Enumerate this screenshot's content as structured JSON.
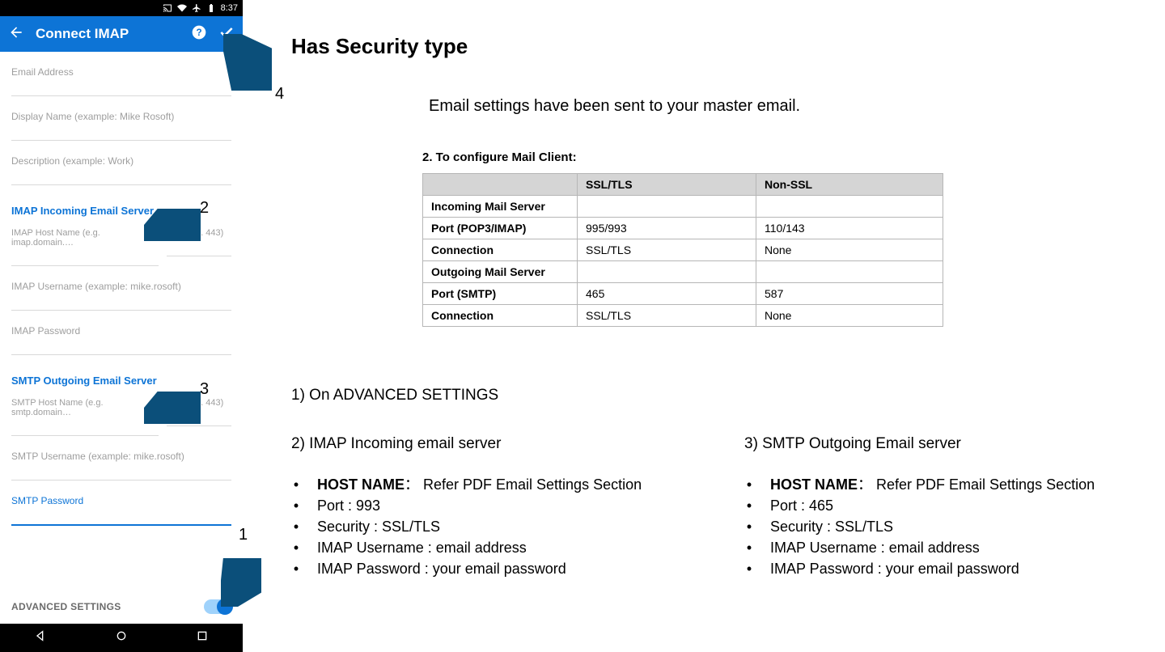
{
  "phone": {
    "status_time": "8:37",
    "title": "Connect IMAP",
    "fields": {
      "email": "Email Address",
      "display": "Display Name (example: Mike Rosoft)",
      "description": "Description (example: Work)"
    },
    "imap": {
      "heading": "IMAP Incoming Email Server",
      "host": "IMAP Host Name (e.g. imap.domain.…",
      "port": "Port (e.g. 443)",
      "user": "IMAP Username (example: mike.rosoft)",
      "pass": "IMAP Password"
    },
    "smtp": {
      "heading": "SMTP Outgoing Email Server",
      "host": "SMTP Host Name (e.g. smtp.domain…",
      "port": "Port (e.g. 443)",
      "user": "SMTP Username (example: mike.rosoft)",
      "pass": "SMTP Password"
    },
    "advanced": "ADVANCED SETTINGS"
  },
  "callouts": {
    "n1": "1",
    "n2": "2",
    "n3": "3",
    "n4": "4"
  },
  "doc": {
    "title": "Has Security type",
    "sent": "Email settings have been sent to your master email.",
    "config_head": "2. To configure Mail Client:",
    "table": {
      "col_ssl": "SSL/TLS",
      "col_non": "Non-SSL",
      "rows": {
        "r1": "Incoming Mail Server",
        "r2": "Port (POP3/IMAP)",
        "r3": "Connection",
        "r4": "Outgoing Mail Server",
        "r5": "Port (SMTP)",
        "r6": "Connection"
      },
      "vals": {
        "r2a": "995/993",
        "r2b": "110/143",
        "r3a": "SSL/TLS",
        "r3b": "None",
        "r5a": "465",
        "r5b": "587",
        "r6a": "SSL/TLS",
        "r6b": "None"
      }
    },
    "step1": "1) On ADVANCED SETTINGS",
    "step2": "2) IMAP Incoming email server",
    "step3": "3) SMTP Outgoing Email server",
    "imap_bullets": {
      "host_label": "HOST NAME",
      "host_rest": "：  Refer PDF Email Settings Section",
      "port": "Port : 993",
      "sec": "Security : SSL/TLS",
      "user": "IMAP Username : email address",
      "pass": "IMAP Password  :  your email password"
    },
    "smtp_bullets": {
      "host_label": "HOST NAME",
      "host_rest": "：  Refer PDF Email Settings Section",
      "port": "Port : 465",
      "sec": "Security : SSL/TLS",
      "user": "IMAP Username : email address",
      "pass": "IMAP Password  :  your email password"
    }
  },
  "chart_data": {
    "type": "table",
    "title": "To configure Mail Client",
    "columns": [
      "",
      "SSL/TLS",
      "Non-SSL"
    ],
    "rows": [
      [
        "Incoming Mail Server",
        "",
        ""
      ],
      [
        "Port (POP3/IMAP)",
        "995/993",
        "110/143"
      ],
      [
        "Connection",
        "SSL/TLS",
        "None"
      ],
      [
        "Outgoing Mail Server",
        "",
        ""
      ],
      [
        "Port (SMTP)",
        "465",
        "587"
      ],
      [
        "Connection",
        "SSL/TLS",
        "None"
      ]
    ]
  }
}
